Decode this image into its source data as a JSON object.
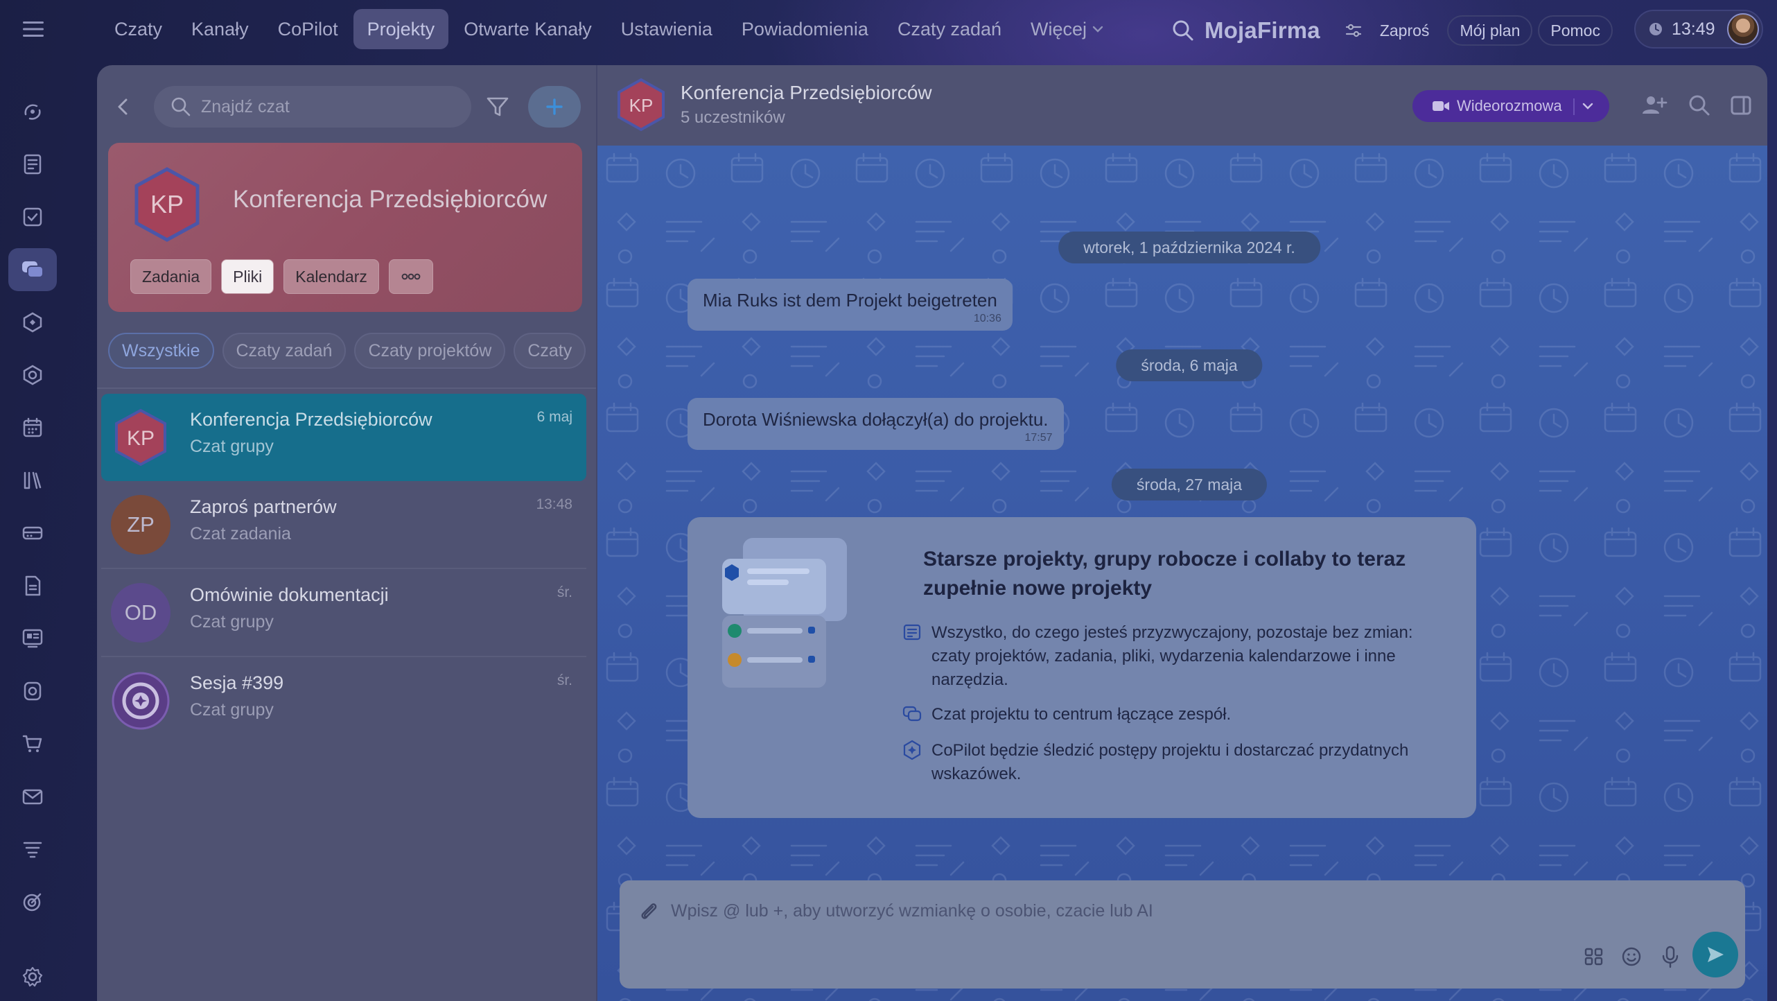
{
  "nav": {
    "items": [
      "Czaty",
      "Kanały",
      "CoPilot",
      "Projekty",
      "Otwarte Kanały",
      "Ustawienia",
      "Powiadomienia",
      "Czaty zadań",
      "Więcej"
    ],
    "active": "Projekty"
  },
  "topbar": {
    "brand": "MojaFirma",
    "invite_label": "Zaproś",
    "plan_label": "Mój plan",
    "help_label": "Pomoc",
    "clock": "13:49"
  },
  "rail": {
    "icons": [
      "copilot-icon",
      "feed-icon",
      "tasks-icon",
      "chats-icon",
      "automation-icon",
      "collabs-icon",
      "calendar-icon",
      "knowledge-icon",
      "crm-icon",
      "documents-icon",
      "sites-icon",
      "marketing-icon",
      "shop-icon",
      "mail-icon",
      "filter-icon",
      "targets-icon",
      "settings-icon"
    ],
    "active": "chats-icon"
  },
  "list": {
    "search_placeholder": "Znajdź czat",
    "project": {
      "initials": "KP",
      "title": "Konferencja Przedsiębiorców",
      "tabs": [
        "Zadania",
        "Pliki",
        "Kalendarz"
      ],
      "active_tab": "Pliki"
    },
    "filters": [
      "Wszystkie",
      "Czaty zadań",
      "Czaty projektów",
      "Czaty"
    ],
    "active_filter": "Wszystkie",
    "chats": [
      {
        "initials": "KP",
        "name": "Konferencja Przedsiębiorców",
        "sub": "Czat grupy",
        "time": "6 maj",
        "color": "#a4425a"
      },
      {
        "initials": "ZP",
        "name": "Zaproś partnerów",
        "sub": "Czat zadania",
        "time": "13:48",
        "color": "#7a4a3a"
      },
      {
        "initials": "OD",
        "name": "Omówinie dokumentacji",
        "sub": "Czat grupy",
        "time": "śr.",
        "color": "#5b4a8c"
      },
      {
        "initials": "",
        "name": "Sesja #399",
        "sub": "Czat grupy",
        "time": "śr.",
        "color": "#5a3d86"
      }
    ]
  },
  "chat": {
    "title": "Konferencja Przedsiębiorców",
    "subtitle": "5 uczestników",
    "initials": "KP",
    "video_label": "Wideorozmowa",
    "dates": [
      "wtorek, 1 października 2024 r.",
      "środa, 6 maja",
      "środa, 27 maja"
    ],
    "messages": [
      {
        "text": "Mia Ruks ist dem Projekt beigetreten",
        "time": "10:36"
      },
      {
        "text": "Dorota Wiśniewska dołączył(a) do projektu.",
        "time": "17:57"
      }
    ],
    "info_card": {
      "title": "Starsze projekty, grupy robocze i collaby to teraz zupełnie nowe projekty",
      "items": [
        "Wszystko, do czego jesteś przyzwyczajony, pozostaje bez zmian: czaty projektów, zadania, pliki, wydarzenia kalendarzowe i inne narzędzia.",
        "Czat projektu to centrum łączące zespół.",
        "CoPilot będzie śledzić postępy projektu i dostarczać przydatnych wskazówek."
      ]
    },
    "composer_placeholder": "Wpisz @ lub +, aby utworzyć wzmiankę o osobie, czacie lub AI"
  }
}
